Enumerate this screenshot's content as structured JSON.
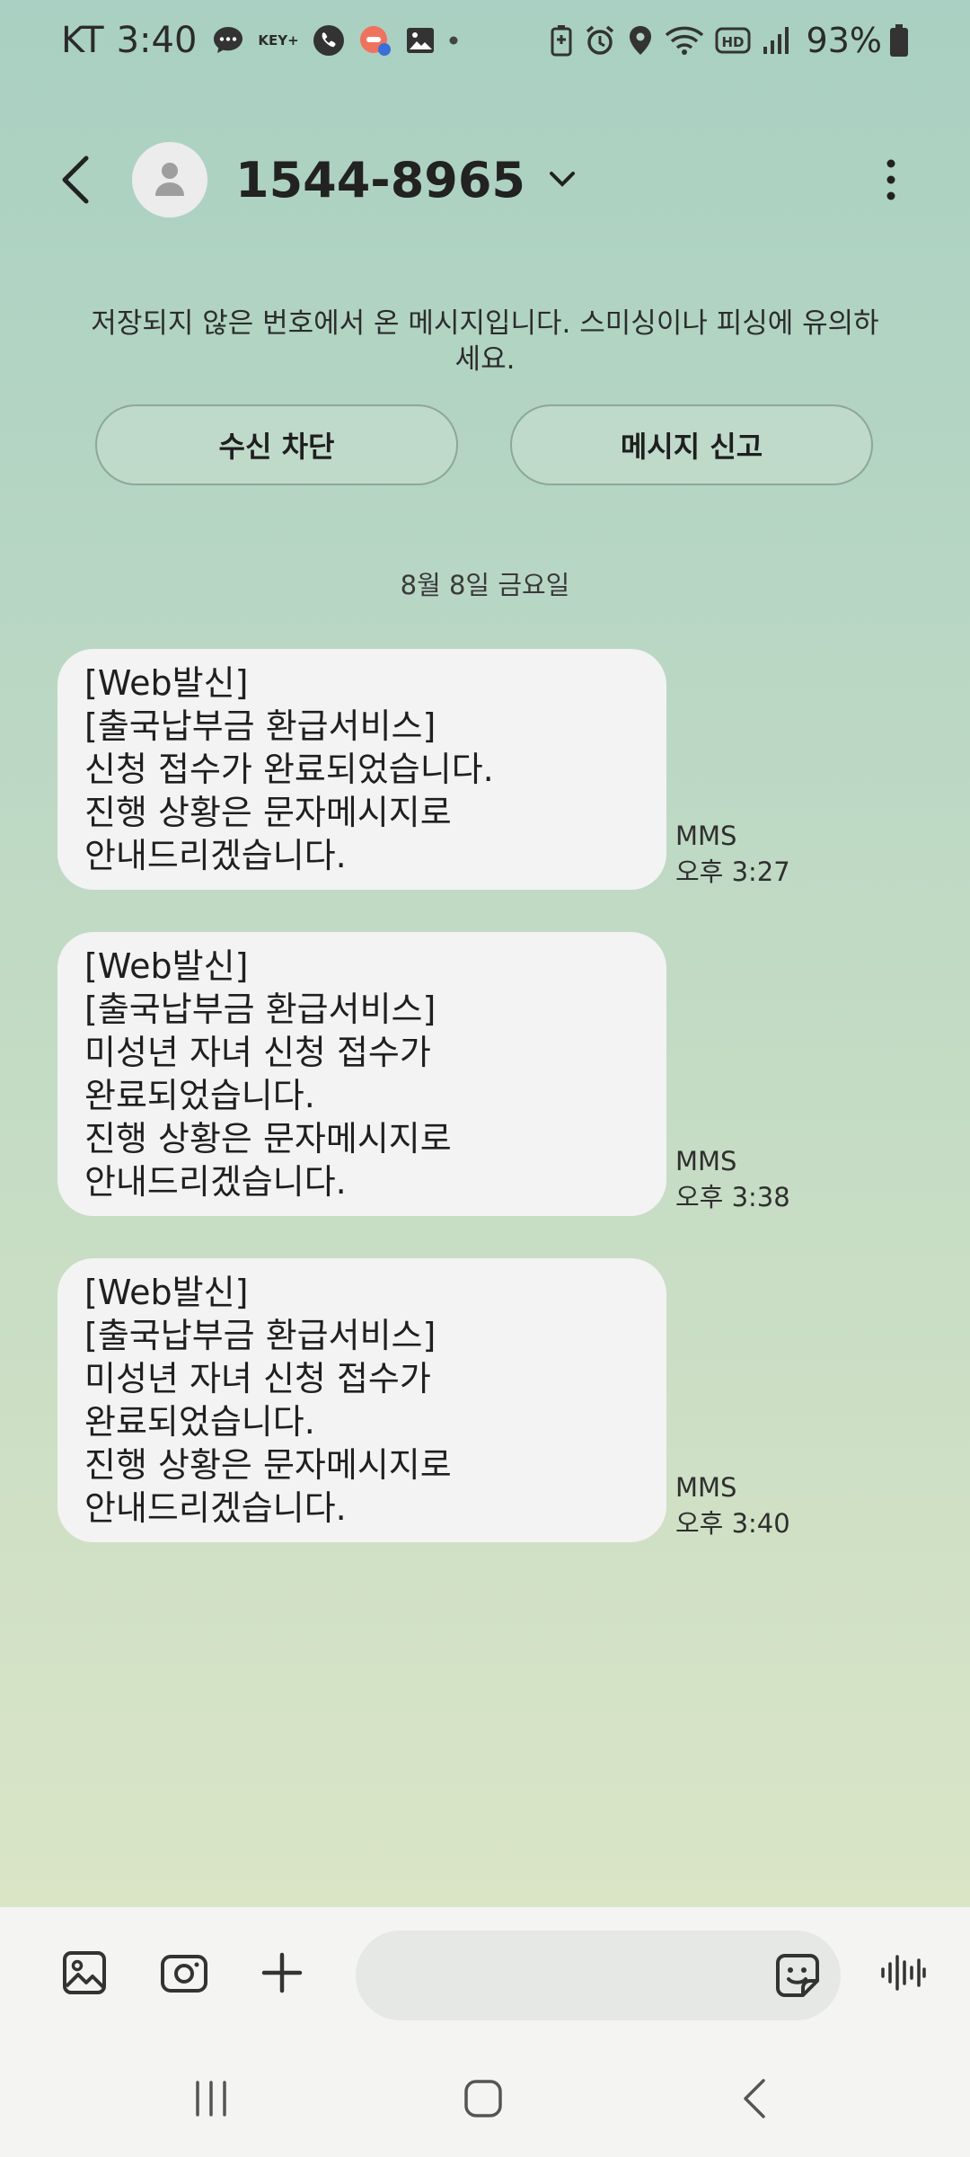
{
  "status_bar": {
    "carrier": "KT",
    "time": "3:40",
    "key_badge": "KEY+",
    "battery_percent": "93%",
    "left_icons": [
      "chat-icon",
      "key-plus-icon",
      "call-record-icon",
      "app-badge-icon",
      "gallery-icon",
      "dot-icon"
    ],
    "right_icons": [
      "battery-saver-icon",
      "alarm-icon",
      "location-icon",
      "wifi-icon",
      "hd-icon",
      "signal-icon",
      "battery-icon"
    ]
  },
  "header": {
    "contact_number": "1544-8965",
    "back_icon": "back-arrow-icon",
    "avatar_icon": "person-icon",
    "more_icon": "more-vertical-icon"
  },
  "warning": {
    "text": "저장되지 않은 번호에서 온 메시지입니다. 스미싱이나 피싱에 유의하세요.",
    "block_label": "수신 차단",
    "report_label": "메시지 신고"
  },
  "date_divider": "8월 8일 금요일",
  "messages": [
    {
      "text": "[Web발신]\n[출국납부금 환급서비스]\n신청 접수가 완료되었습니다.\n진행 상황은 문자메시지로\n안내드리겠습니다.",
      "type": "MMS",
      "time": "오후 3:27"
    },
    {
      "text": "[Web발신]\n[출국납부금 환급서비스]\n미성년 자녀 신청 접수가\n완료되었습니다.\n진행 상황은 문자메시지로\n안내드리겠습니다.",
      "type": "MMS",
      "time": "오후 3:38"
    },
    {
      "text": "[Web발신]\n[출국납부금 환급서비스]\n미성년 자녀 신청 접수가\n완료되었습니다.\n진행 상황은 문자메시지로\n안내드리겠습니다.",
      "type": "MMS",
      "time": "오후 3:40"
    }
  ],
  "input_bar": {
    "placeholder": "",
    "icons": [
      "gallery-icon",
      "camera-icon",
      "plus-icon",
      "sticker-icon",
      "voice-wave-icon"
    ]
  },
  "nav_bar": {
    "icons": [
      "recent-apps-icon",
      "home-icon",
      "nav-back-icon"
    ]
  },
  "colors": {
    "bubble": "#f3f3f3",
    "bg_top": "#a9d0c2",
    "bg_bottom": "#e1e8c7",
    "pill_border": "#8ea797"
  }
}
